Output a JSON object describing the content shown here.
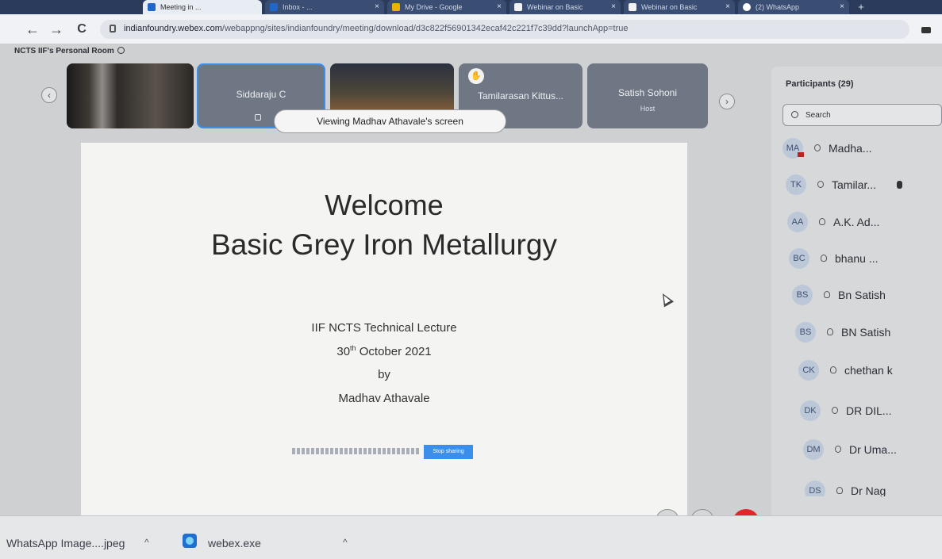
{
  "browser": {
    "tabs": [
      {
        "label": "Meeting in ..."
      },
      {
        "label": "Inbox - ..."
      },
      {
        "label": "My Drive - Google"
      },
      {
        "label": "Webinar on Basic"
      },
      {
        "label": "Webinar on Basic"
      },
      {
        "label": "(2) WhatsApp"
      }
    ],
    "url_host": "indianfoundry.webex.com",
    "url_path": "/webappng/sites/indianfoundry/meeting/download/d3c822f56901342ecaf42c221f7c39dd?launchApp=true"
  },
  "meeting": {
    "room_title": "NCTS IIF's Personal Room",
    "tiles": [
      {
        "name": "",
        "sub": ""
      },
      {
        "name": "Siddaraju C",
        "sub": ""
      },
      {
        "name": "",
        "sub": ""
      },
      {
        "name": "Tamilarasan Kittus...",
        "sub": ""
      },
      {
        "name": "Satish Sohoni",
        "sub": "Host"
      }
    ],
    "viewing_label": "Viewing Madhav Athavale's screen",
    "slide": {
      "title_line1": "Welcome",
      "title_line2": "Basic Grey Iron Metallurgy",
      "line1": "IIF NCTS Technical Lecture",
      "date_day": "30",
      "date_suffix": "th",
      "date_rest": " October 2021",
      "line3": "by",
      "line4": "Madhav Athavale"
    },
    "share_banner": {
      "stop_label": "Stop sharing"
    }
  },
  "participants": {
    "title": "Participants (29)",
    "search_placeholder": "Search",
    "list": [
      {
        "initials": "MA",
        "name": "Madha..."
      },
      {
        "initials": "TK",
        "name": "Tamilar..."
      },
      {
        "initials": "AA",
        "name": "A.K. Ad..."
      },
      {
        "initials": "BC",
        "name": "bhanu ..."
      },
      {
        "initials": "BS",
        "name": "Bn Satish"
      },
      {
        "initials": "BS",
        "name": "BN Satish"
      },
      {
        "initials": "CK",
        "name": "chethan k"
      },
      {
        "initials": "DK",
        "name": "DR DIL..."
      },
      {
        "initials": "DM",
        "name": "Dr Uma..."
      },
      {
        "initials": "DS",
        "name": "Dr Nag"
      }
    ]
  },
  "taskbar": {
    "download1": "WhatsApp Image....jpeg",
    "download2": "webex.exe"
  },
  "colors": {
    "accent": "#3b8eea",
    "leave": "#e0262b"
  }
}
